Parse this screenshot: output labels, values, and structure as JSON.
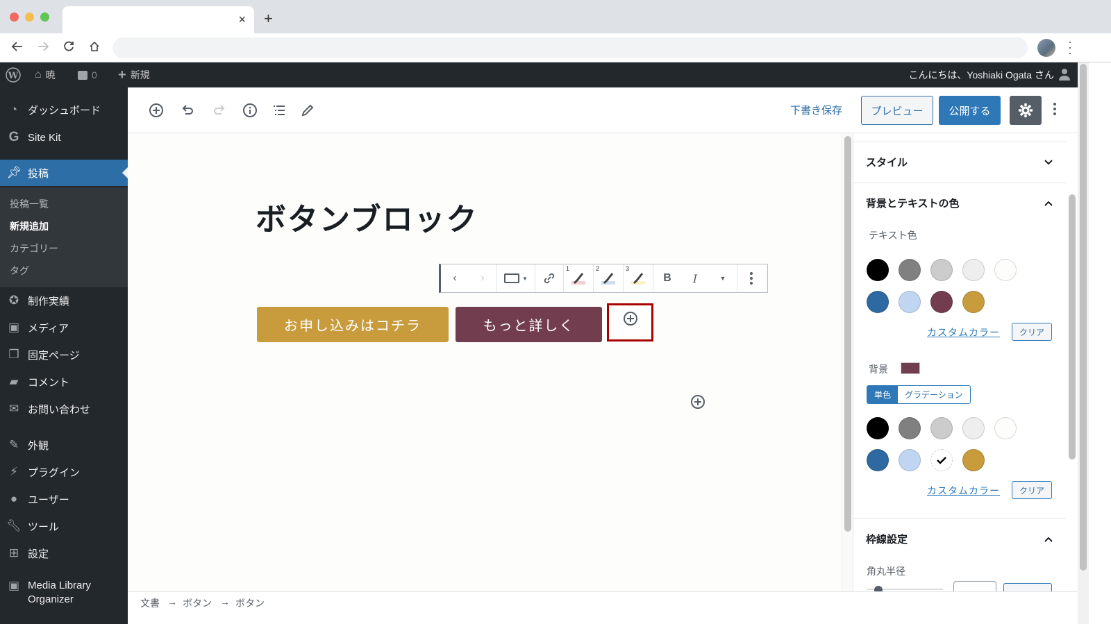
{
  "browser": {
    "tab_title": "",
    "close_tab": "×",
    "new_tab": "+",
    "address": ""
  },
  "adminbar": {
    "site_name": "暁",
    "comment_count": "0",
    "new_label": "新規",
    "greeting": "こんにちは、Yoshiaki Ogata さん"
  },
  "sidebar": {
    "items": [
      {
        "label": "ダッシュボード",
        "icon": "dashboard-icon"
      },
      {
        "label": "Site Kit",
        "icon": "google-icon"
      },
      {
        "label": "投稿",
        "icon": "pin-icon",
        "active": true
      },
      {
        "label": "制作実績",
        "icon": "award-icon"
      },
      {
        "label": "メディア",
        "icon": "media-icon"
      },
      {
        "label": "固定ページ",
        "icon": "pages-icon"
      },
      {
        "label": "コメント",
        "icon": "comment-icon"
      },
      {
        "label": "お問い合わせ",
        "icon": "mail-icon"
      },
      {
        "label": "外観",
        "icon": "appearance-icon"
      },
      {
        "label": "プラグイン",
        "icon": "plugin-icon"
      },
      {
        "label": "ユーザー",
        "icon": "user-icon"
      },
      {
        "label": "ツール",
        "icon": "wrench-icon"
      },
      {
        "label": "設定",
        "icon": "settings-icon"
      },
      {
        "label": "Media Library Organizer",
        "icon": "media-icon"
      }
    ],
    "submenu": [
      {
        "label": "投稿一覧"
      },
      {
        "label": "新規追加",
        "current": true
      },
      {
        "label": "カテゴリー"
      },
      {
        "label": "タグ"
      }
    ]
  },
  "editor_header": {
    "save_draft": "下書き保存",
    "preview": "プレビュー",
    "publish": "公開する"
  },
  "post": {
    "title": "ボタンブロック",
    "buttons": [
      {
        "label": "お申し込みはコチラ",
        "color": "#c89b3c"
      },
      {
        "label": "もっと詳しく",
        "color": "#723d4f"
      }
    ]
  },
  "block_toolbar": {
    "highlight_1": "1",
    "highlight_2": "2",
    "highlight_3": "3",
    "bold": "B",
    "italic": "I"
  },
  "settings_panel": {
    "style_section": "スタイル",
    "color_section": "背景とテキストの色",
    "text_color_label": "テキスト色",
    "background_label": "背景",
    "background_value": "#723d4f",
    "solid_tab": "単色",
    "gradient_tab": "グラデーション",
    "custom_color": "カスタムカラー",
    "clear": "クリア",
    "border_section": "枠線設定",
    "radius_label": "角丸半径",
    "palette": [
      "#000000",
      "#808080",
      "#cccccc",
      "#eeeeee",
      "#fdfdfc",
      "#2e6aa1",
      "#c0d5f2",
      "#723d4f",
      "#c89b3c"
    ],
    "selected_background_index": 7
  },
  "breadcrumb": {
    "items": [
      "文書",
      "ボタン",
      "ボタン"
    ],
    "separator": "→"
  }
}
